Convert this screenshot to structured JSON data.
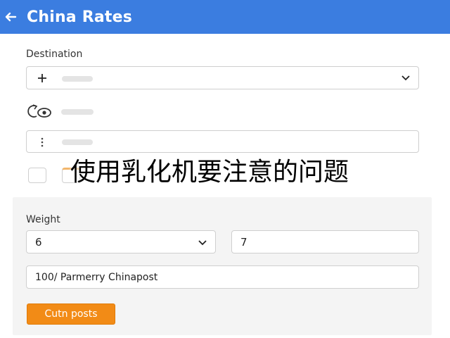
{
  "header": {
    "title": "China Rates",
    "back_icon": "arrow-left-icon",
    "background": "#3b7de0"
  },
  "destination": {
    "label": "Destination",
    "add_icon": "plus-icon",
    "dropdown_icon": "chevron-down-icon"
  },
  "service_row": {
    "icon": "refresh-eye-icon"
  },
  "options_row": {
    "icon": "more-vertical-icon"
  },
  "overlay": {
    "text": "使用乳化机要注意的问题"
  },
  "weight": {
    "label": "Weight",
    "value": "6",
    "dropdown_icon": "chevron-down-icon",
    "second_value": "7"
  },
  "service_field": {
    "value": "100/ Parmerry Chinapost"
  },
  "submit_button": {
    "label": "Cutn posts",
    "color": "#f28b16"
  }
}
